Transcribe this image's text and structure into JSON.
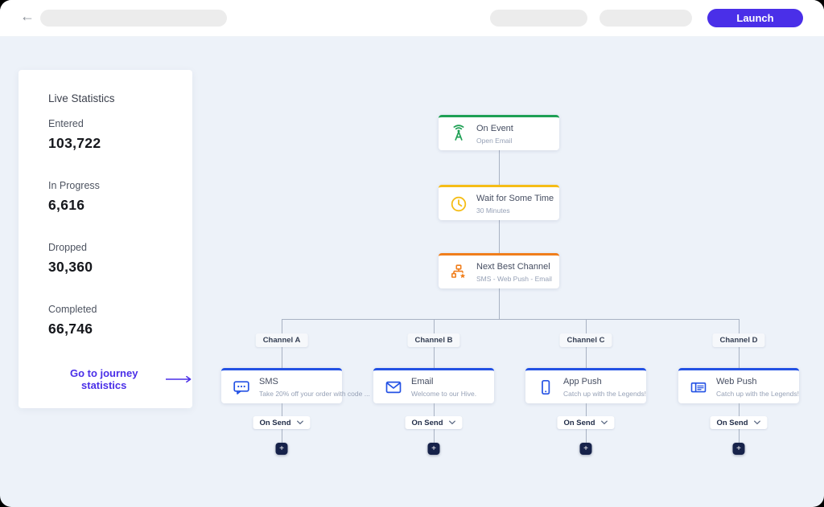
{
  "topbar": {
    "back_icon": "←",
    "launch_label": "Launch"
  },
  "stats_panel": {
    "title": "Live Statistics",
    "items": [
      {
        "label": "Entered",
        "value": "103,722"
      },
      {
        "label": "In Progress",
        "value": "6,616"
      },
      {
        "label": "Dropped",
        "value": "30,360"
      },
      {
        "label": "Completed",
        "value": "66,746"
      }
    ],
    "link_label": "Go to journey statistics"
  },
  "flow": {
    "main_nodes": [
      {
        "title": "On Event",
        "subtitle": "Open Email",
        "accent": "#1fa055",
        "icon": "broadcast-icon"
      },
      {
        "title": "Wait for Some Time",
        "subtitle": "30 Minutes",
        "accent": "#f5bd17",
        "icon": "clock-icon"
      },
      {
        "title": "Next Best Channel",
        "subtitle": "SMS - Web Push - Email",
        "accent": "#f07e1c",
        "icon": "hierarchy-star-icon"
      }
    ],
    "branches": [
      {
        "label": "Channel A",
        "title": "SMS",
        "subtitle": "Take 20% off your order with code ...",
        "icon": "sms-icon"
      },
      {
        "label": "Channel B",
        "title": "Email",
        "subtitle": "Welcome to our Hive.",
        "icon": "email-icon"
      },
      {
        "label": "Channel C",
        "title": "App Push",
        "subtitle": "Catch up with the Legends!",
        "icon": "app-push-icon"
      },
      {
        "label": "Channel D",
        "title": "Web Push",
        "subtitle": "Catch up with the Legends!",
        "icon": "web-push-icon"
      }
    ],
    "branch_trigger_label": "On Send",
    "branch_accent": "#2452e4",
    "add_button_label": "+"
  },
  "colors": {
    "accent_purple": "#4a2fe8",
    "branch_blue": "#2452e4",
    "event_green": "#1fa055",
    "wait_yellow": "#f5bd17",
    "nbc_orange": "#f07e1c",
    "connector_gray": "#a8b2c3",
    "canvas_bg": "#edf2f9",
    "plus_navy": "#16224a"
  }
}
